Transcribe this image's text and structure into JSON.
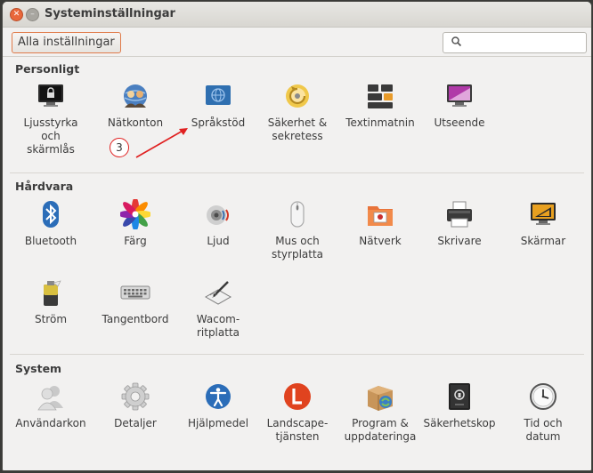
{
  "window": {
    "title": "Systeminställningar"
  },
  "toolbar": {
    "all_settings_label": "Alla inställningar",
    "search_value": ""
  },
  "sections": {
    "personal": {
      "title": "Personligt",
      "items": [
        {
          "label": "Ljusstyrka\noch\nskärmlås",
          "icon": "lock-screen-icon"
        },
        {
          "label": "Nätkonton",
          "icon": "online-accounts-icon"
        },
        {
          "label": "Språkstöd",
          "icon": "language-support-icon"
        },
        {
          "label": "Säkerhet &\nsekretess",
          "icon": "security-privacy-icon"
        },
        {
          "label": "Textinmatnin",
          "icon": "text-entry-icon"
        },
        {
          "label": "Utseende",
          "icon": "appearance-icon"
        }
      ]
    },
    "hardware": {
      "title": "Hårdvara",
      "items": [
        {
          "label": "Bluetooth",
          "icon": "bluetooth-icon"
        },
        {
          "label": "Färg",
          "icon": "color-icon"
        },
        {
          "label": "Ljud",
          "icon": "sound-icon"
        },
        {
          "label": "Mus och\nstyrplatta",
          "icon": "mouse-icon"
        },
        {
          "label": "Nätverk",
          "icon": "network-icon"
        },
        {
          "label": "Skrivare",
          "icon": "printer-icon"
        },
        {
          "label": "Skärmar",
          "icon": "displays-icon"
        },
        {
          "label": "Ström",
          "icon": "power-icon"
        },
        {
          "label": "Tangentbord",
          "icon": "keyboard-icon"
        },
        {
          "label": "Wacom-\nritplatta",
          "icon": "wacom-tablet-icon"
        }
      ]
    },
    "system": {
      "title": "System",
      "items": [
        {
          "label": "Användarkon",
          "icon": "user-accounts-icon"
        },
        {
          "label": "Detaljer",
          "icon": "details-icon"
        },
        {
          "label": "Hjälpmedel",
          "icon": "accessibility-icon"
        },
        {
          "label": "Landscape-\ntjänsten",
          "icon": "landscape-icon"
        },
        {
          "label": "Program &\nuppdateringa",
          "icon": "software-updates-icon"
        },
        {
          "label": "Säkerhetskop",
          "icon": "backup-icon"
        },
        {
          "label": "Tid och\ndatum",
          "icon": "time-date-icon"
        }
      ]
    }
  },
  "annotation": {
    "number": "3"
  },
  "colors": {
    "accent": "#e07b4a",
    "annotation": "#e02020",
    "text": "#3c3c3c"
  }
}
